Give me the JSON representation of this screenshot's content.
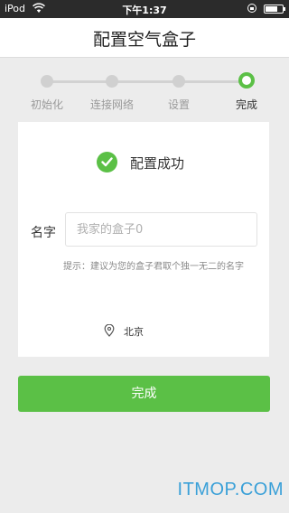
{
  "status_bar": {
    "carrier": "iPod",
    "time": "下午1:37",
    "icons": [
      "wifi-icon",
      "lock-rotation-icon",
      "battery-icon"
    ]
  },
  "header": {
    "title": "配置空气盒子"
  },
  "stepper": {
    "steps": [
      {
        "label": "初始化",
        "active": false
      },
      {
        "label": "连接网络",
        "active": false
      },
      {
        "label": "设置",
        "active": false
      },
      {
        "label": "完成",
        "active": true
      }
    ],
    "accent_color": "#5bc046"
  },
  "card": {
    "success_text": "配置成功",
    "name_label": "名字",
    "name_input": {
      "value": "",
      "placeholder": "我家的盒子0"
    },
    "hint": "提示：建议为您的盒子君取个独一无二的名字",
    "location": "北京"
  },
  "done_button": {
    "label": "完成"
  },
  "watermark": "ITMOP.COM"
}
